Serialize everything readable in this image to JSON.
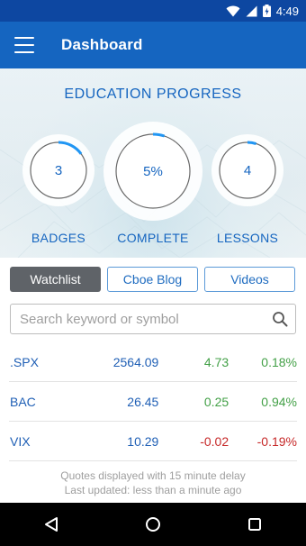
{
  "status_bar": {
    "time": "4:49"
  },
  "toolbar": {
    "title": "Dashboard"
  },
  "education": {
    "heading": "EDUCATION PROGRESS",
    "badges": {
      "value": "3",
      "label": "BADGES",
      "progress": 0.15
    },
    "complete": {
      "value": "5%",
      "label": "COMPLETE",
      "progress": 0.05
    },
    "lessons": {
      "value": "4",
      "label": "LESSONS",
      "progress": 0.05
    }
  },
  "tabs": [
    {
      "label": "Watchlist",
      "active": true
    },
    {
      "label": "Cboe Blog",
      "active": false
    },
    {
      "label": "Videos",
      "active": false
    }
  ],
  "search": {
    "placeholder": "Search keyword or symbol"
  },
  "watchlist": [
    {
      "symbol": ".SPX",
      "price": "2564.09",
      "change": "4.73",
      "percent": "0.18%",
      "direction": "up"
    },
    {
      "symbol": "BAC",
      "price": "26.45",
      "change": "0.25",
      "percent": "0.94%",
      "direction": "up"
    },
    {
      "symbol": "VIX",
      "price": "10.29",
      "change": "-0.02",
      "percent": "-0.19%",
      "direction": "down"
    }
  ],
  "footer": {
    "line1": "Quotes displayed with 15 minute delay",
    "line2": "Last updated: less than a minute ago"
  },
  "colors": {
    "brand": "#1565c0",
    "status_bar": "#0d47a1",
    "positive": "#43a047",
    "negative": "#c62828"
  }
}
